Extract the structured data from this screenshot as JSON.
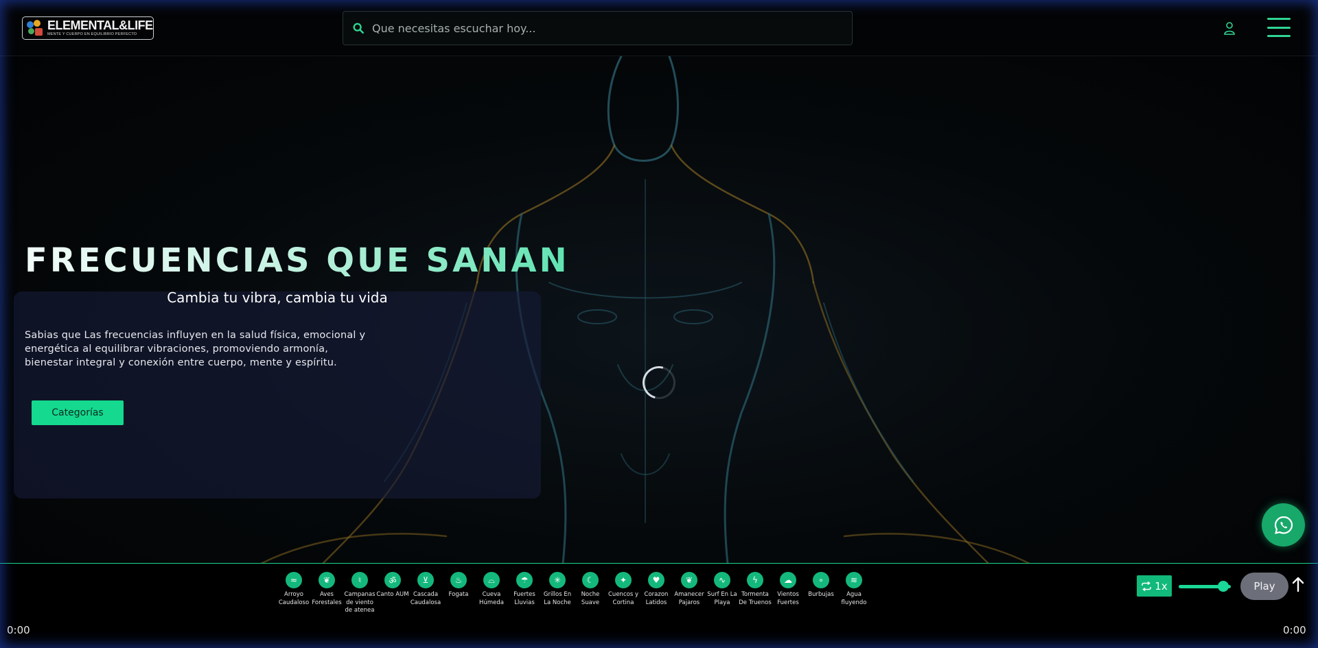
{
  "header": {
    "logo_title": "ELEMENTAL&LIFE",
    "logo_subtitle": "MENTE Y CUERPO EN EQUILIBRIO PERFECTO",
    "search_placeholder": "Que necesitas escuchar hoy...",
    "icons": [
      "search-icon",
      "user-icon",
      "hamburger-menu-icon"
    ]
  },
  "hero": {
    "title": "FRECUENCIAS QUE SANAN",
    "subtitle": "Cambia tu vibra, cambia tu vida",
    "text": "Sabias que Las frecuencias influyen en la salud física, emocional y energética al equilibrar vibraciones, promoviendo armonía, bienestar integral y conexión entre cuerpo, mente y espíritu.",
    "button_label": "Categorías"
  },
  "player": {
    "sounds": [
      {
        "label": "Arroyo Caudaloso",
        "icon": "stream-icon"
      },
      {
        "label": "Aves Forestales",
        "icon": "bird-icon"
      },
      {
        "label": "Campanas de viento de atenea",
        "icon": "wind-chime-icon"
      },
      {
        "label": "Canto AUM",
        "icon": "om-icon"
      },
      {
        "label": "Cascada Caudalosa",
        "icon": "waterfall-icon"
      },
      {
        "label": "Fogata",
        "icon": "campfire-icon"
      },
      {
        "label": "Cueva Húmeda",
        "icon": "cave-icon"
      },
      {
        "label": "Fuertes Lluvias",
        "icon": "heavy-rain-icon"
      },
      {
        "label": "Grillos En La Noche",
        "icon": "cricket-icon"
      },
      {
        "label": "Noche Suave",
        "icon": "moon-icon"
      },
      {
        "label": "Cuencos y Cortina",
        "icon": "sparkle-icon"
      },
      {
        "label": "Corazon Latidos",
        "icon": "heart-icon"
      },
      {
        "label": "Amanecer Pajaros",
        "icon": "bird-icon"
      },
      {
        "label": "Surf En La Playa",
        "icon": "waves-icon"
      },
      {
        "label": "Tormenta De Truenos",
        "icon": "thunderstorm-icon"
      },
      {
        "label": "Vientos Fuertes",
        "icon": "strong-wind-icon"
      },
      {
        "label": "Burbujas",
        "icon": "bubbles-icon"
      },
      {
        "label": "Agua fluyendo",
        "icon": "flowing-water-icon"
      }
    ],
    "time_current": "0:00",
    "time_total": "0:00",
    "loop_label": "1x",
    "volume_level": 0.85,
    "play_label": "Play"
  },
  "colors": {
    "accent": "#14d98f",
    "sound_icon_bg": "#14b87c",
    "whatsapp": "#17a86a",
    "play_button": "#6c6f7a"
  }
}
